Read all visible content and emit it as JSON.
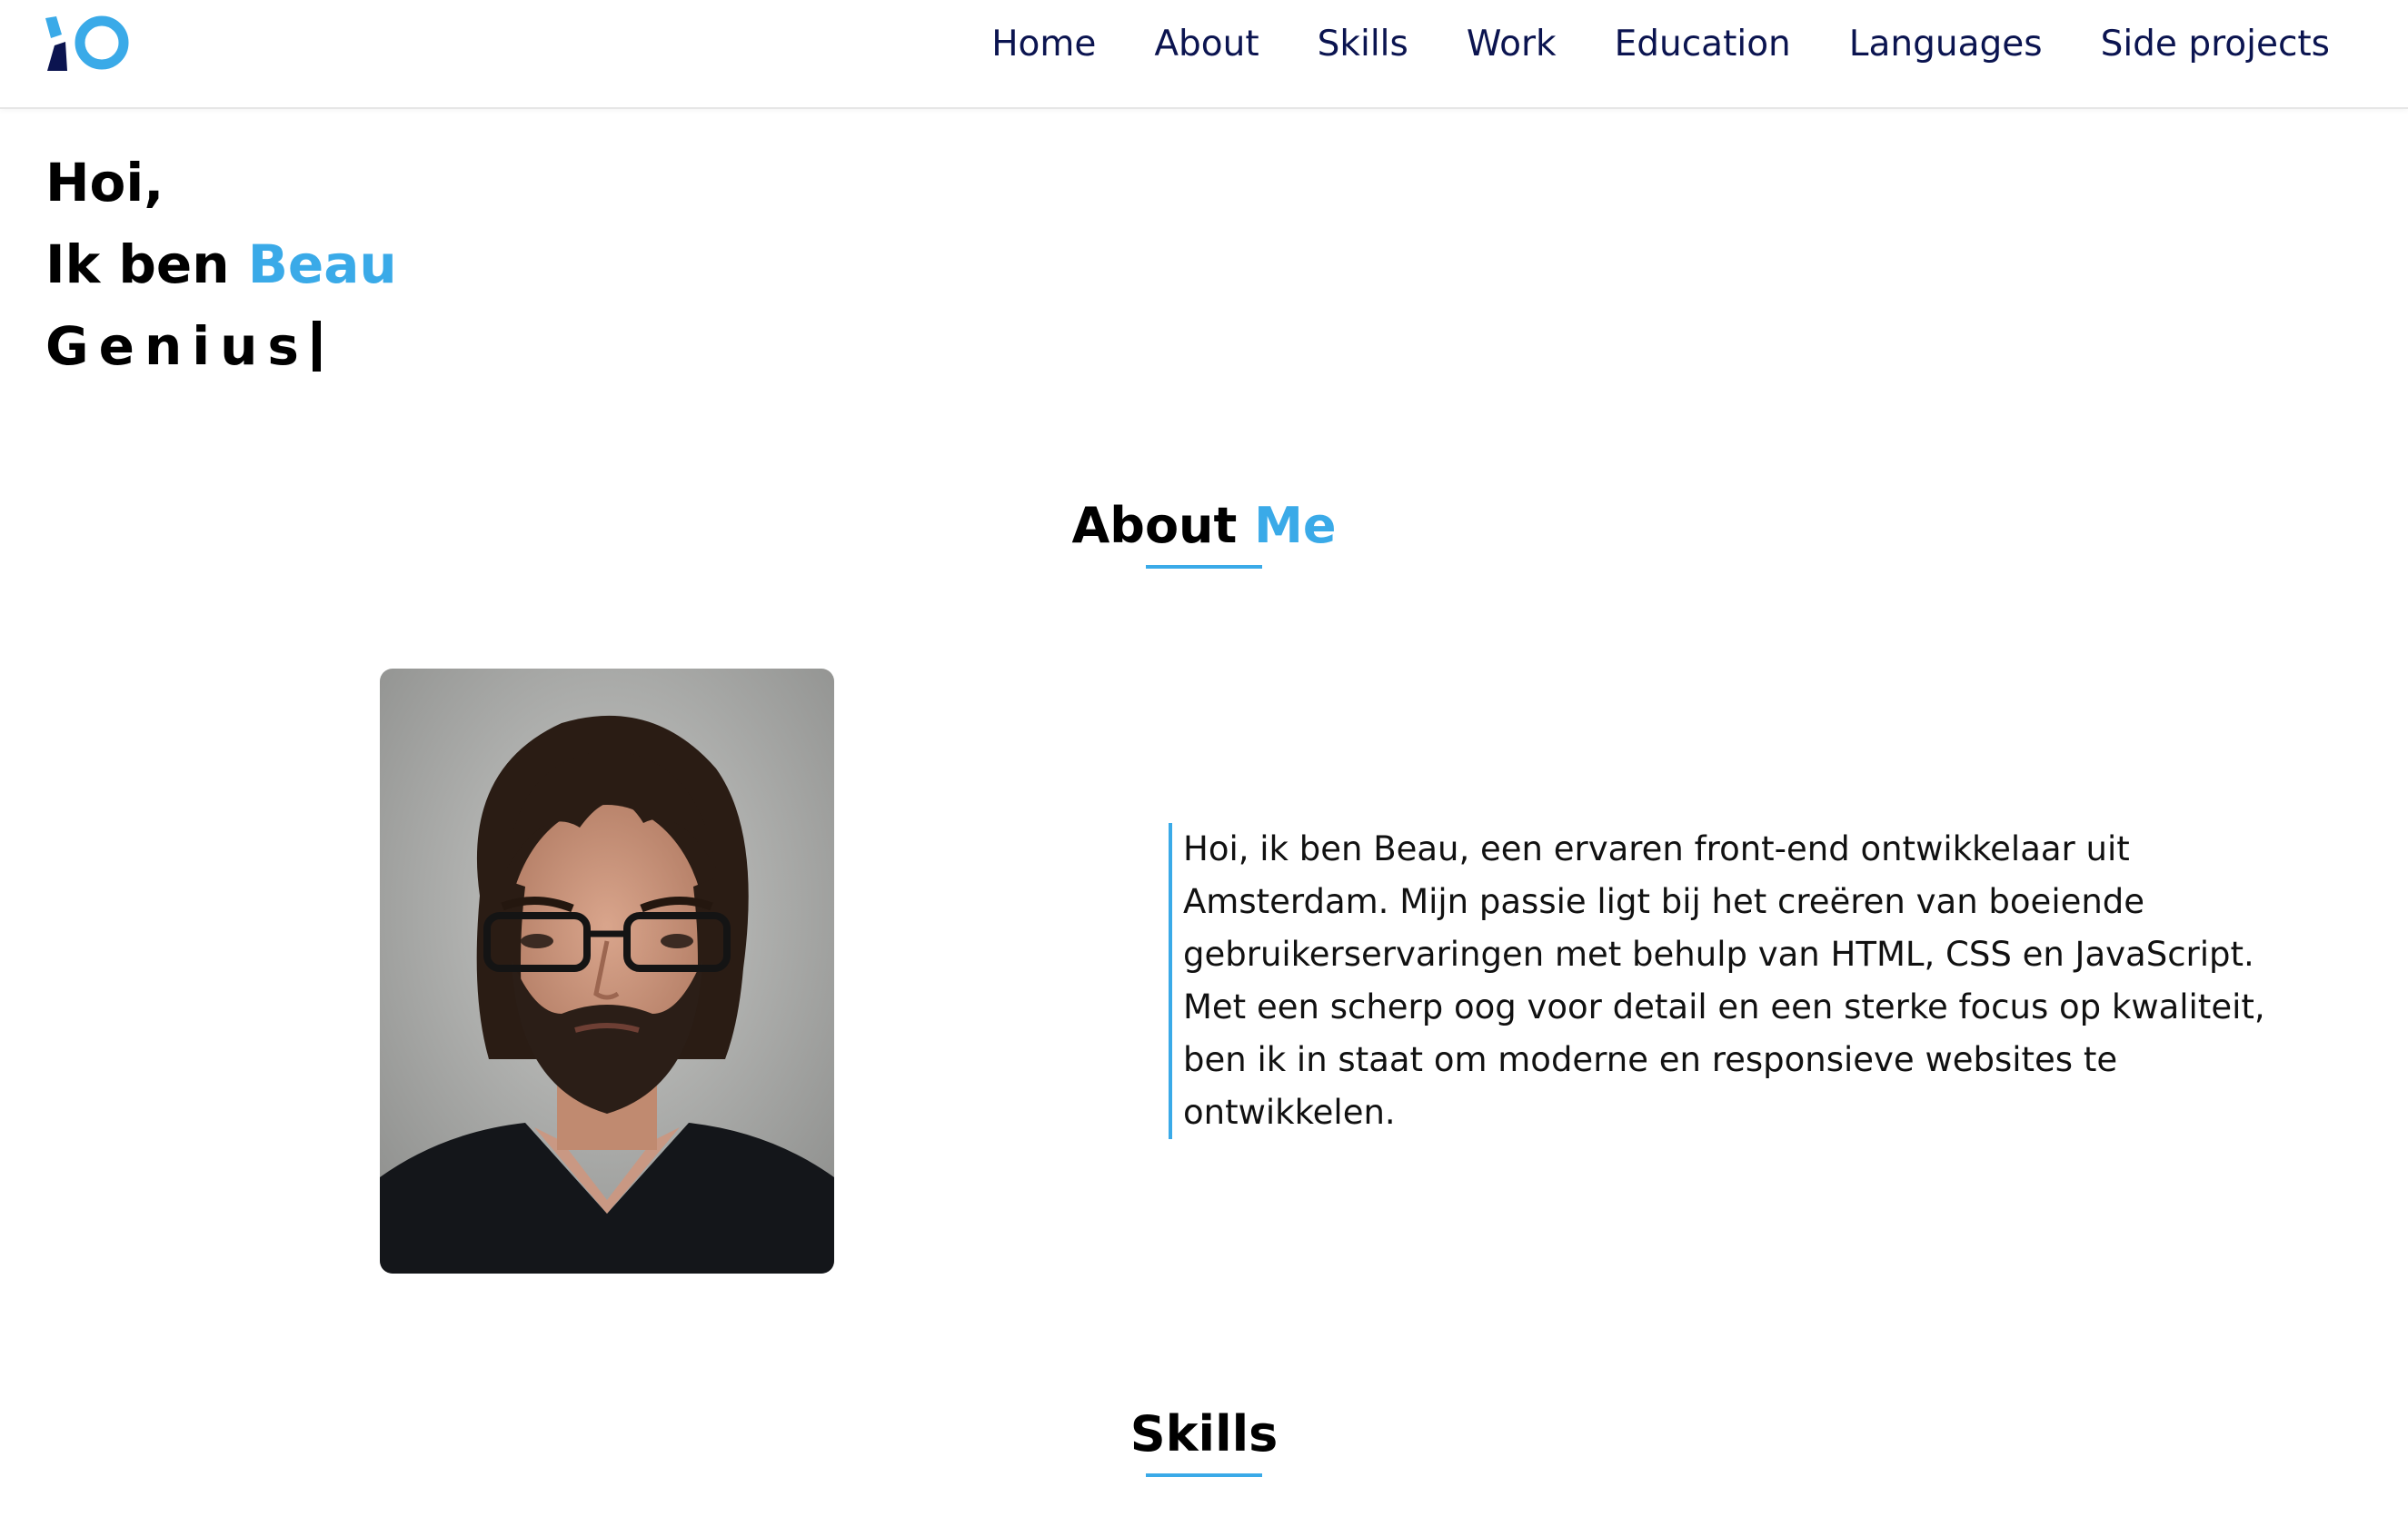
{
  "nav": {
    "items": [
      {
        "label": "Home"
      },
      {
        "label": "About"
      },
      {
        "label": "Skills"
      },
      {
        "label": "Work"
      },
      {
        "label": "Education"
      },
      {
        "label": "Languages"
      },
      {
        "label": "Side projects"
      }
    ]
  },
  "hero": {
    "greeting": "Hoi,",
    "intro_prefix": "Ik ben",
    "name": "Beau",
    "typed_word": "Genius"
  },
  "about": {
    "title_main": "About",
    "title_accent": "Me",
    "text": "Hoi, ik ben Beau, een ervaren front-end ontwikkelaar uit Amsterdam. Mijn passie ligt bij het creëren van boeiende gebruikerservaringen met behulp van HTML, CSS en JavaScript. Met een scherp oog voor detail en een sterke focus op kwaliteit, ben ik in staat om moderne en responsieve websites te ontwikkelen."
  },
  "skills": {
    "title": "Skills"
  },
  "colors": {
    "accent": "#3aaae8",
    "nav_text": "#0b1450",
    "logo_dark": "#0b1450"
  }
}
